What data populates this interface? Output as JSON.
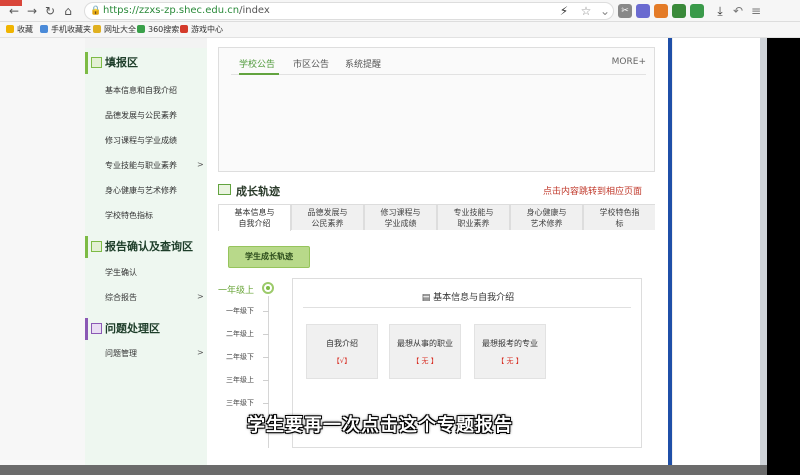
{
  "browser": {
    "url_secure": "https://zzxs-zp.shec.edu.cn",
    "url_path": "/index",
    "bookmarks": [
      "收藏",
      "手机收藏夹",
      "网址大全",
      "360搜索",
      "游戏中心"
    ]
  },
  "sidebar": {
    "sections": [
      {
        "title": "填报区",
        "items": [
          "基本信息和自我介绍",
          "品德发展与公民素养",
          "修习课程与学业成绩",
          "专业技能与职业素养",
          "身心健康与艺术修养",
          "学校特色指标"
        ]
      },
      {
        "title": "报告确认及查询区",
        "items": [
          "学生确认",
          "综合报告"
        ]
      },
      {
        "title": "问题处理区",
        "items": [
          "问题管理"
        ]
      }
    ],
    "chevron": ">"
  },
  "notice": {
    "tabs": [
      "学校公告",
      "市区公告",
      "系统提醒"
    ],
    "more": "MORE+"
  },
  "growth": {
    "title": "成长轨迹",
    "hint": "点击内容跳转到相应页面",
    "tabs": [
      "基本信息与\n自我介绍",
      "品德发展与\n公民素养",
      "修习课程与\n学业成绩",
      "专业技能与\n职业素养",
      "身心健康与\n艺术修养",
      "学校特色指\n标"
    ],
    "badge": "学生成长轨迹",
    "grades": [
      "一年级上",
      "一年级下",
      "二年级上",
      "二年级下",
      "三年级上",
      "三年级下"
    ],
    "card": {
      "title": "基本信息与自我介绍",
      "items": [
        {
          "label": "自我介绍",
          "value": "【√】"
        },
        {
          "label": "最想从事的职业",
          "value": "【 无 】"
        },
        {
          "label": "最想报考的专业",
          "value": "【 无 】"
        }
      ]
    }
  },
  "subtitle": "学生要再一次点击这个专题报告"
}
